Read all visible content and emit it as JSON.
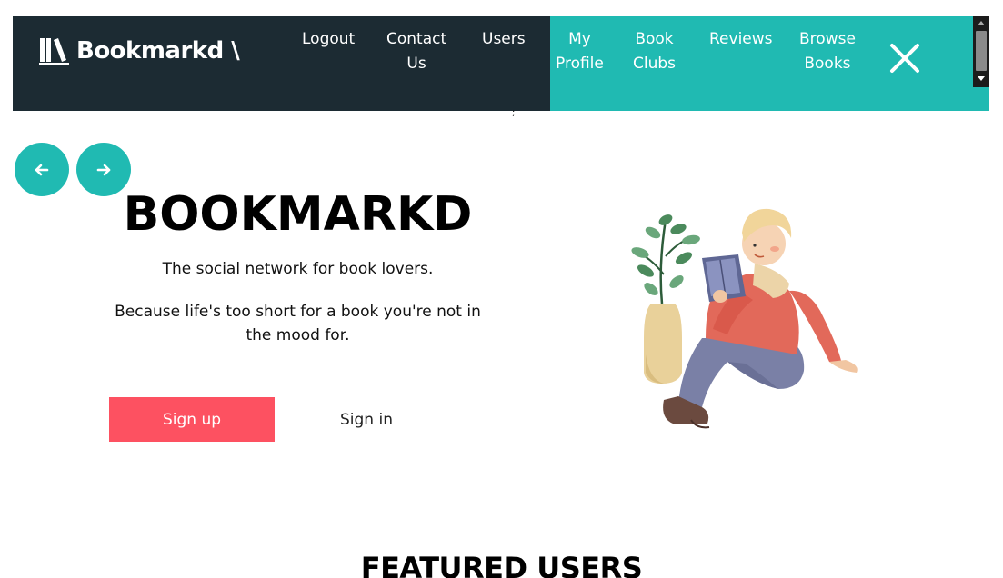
{
  "brand": {
    "name": "Bookmarkd \\"
  },
  "nav": {
    "logout": "Logout",
    "contact_1": "Contact",
    "contact_2": "Us",
    "users": "Users",
    "profile_1": "My",
    "profile_2": "Profile",
    "clubs_1": "Book",
    "clubs_2": "Clubs",
    "reviews": "Reviews",
    "browse_1": "Browse",
    "browse_2": "Books",
    "stray_mark": ";"
  },
  "hero": {
    "title": "BOOKMARKD",
    "subtitle": "The social network for book lovers.",
    "tagline": "Because life's too short for a book you're not in the mood for.",
    "signup": "Sign up",
    "signin": "Sign in"
  },
  "featured": {
    "heading": "FEATURED USERS"
  },
  "colors": {
    "nav_dark": "#1c2b33",
    "teal": "#20bab2",
    "signup": "#fd5161"
  },
  "icons": {
    "brand": "books-icon",
    "close": "close-icon",
    "prev": "arrow-left-icon",
    "next": "arrow-right-icon"
  }
}
